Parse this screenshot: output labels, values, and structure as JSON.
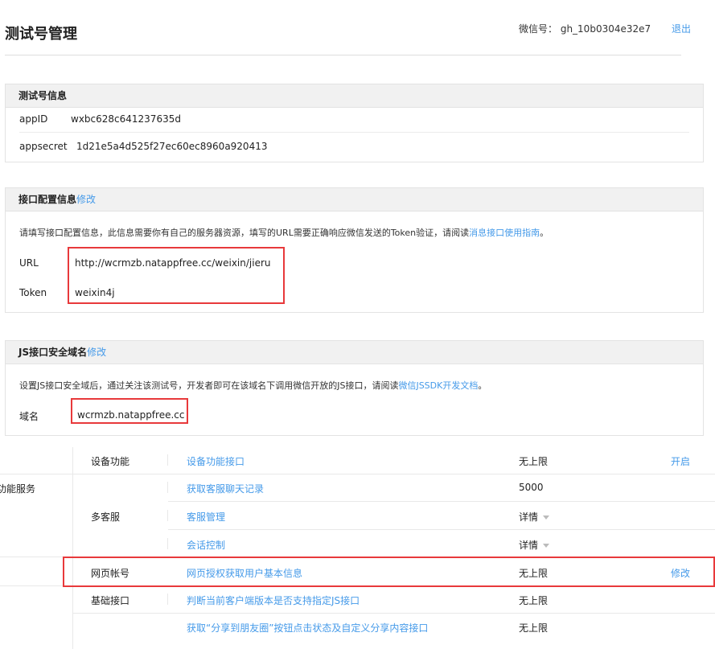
{
  "header": {
    "title": "测试号管理",
    "wechat_id_label": "微信号：",
    "wechat_id_value": "gh_10b0304e32e7",
    "logout": "退出"
  },
  "test_info": {
    "title": "测试号信息",
    "rows": [
      {
        "key": "appID",
        "value": "wxbc628c641237635d"
      },
      {
        "key": "appsecret",
        "value": "1d21e5a4d525f27ec60ec8960a920413"
      }
    ]
  },
  "api_config": {
    "title": "接口配置信息",
    "edit": "修改",
    "desc_prefix": "请填写接口配置信息，此信息需要你有自己的服务器资源，填写的URL需要正确响应微信发送的Token验证，请阅读",
    "desc_link": "消息接口使用指南",
    "desc_suffix": "。",
    "url_label": "URL",
    "url_value": "http://wcrmzb.natappfree.cc/weixin/jieru",
    "token_label": "Token",
    "token_value": "weixin4j"
  },
  "js_domain": {
    "title": "JS接口安全域名",
    "edit": "修改",
    "desc_prefix": "设置JS接口安全域后，通过关注该测试号，开发者即可在该域名下调用微信开放的JS接口，请阅读",
    "desc_link": "微信JSSDK开发文档",
    "desc_suffix": "。",
    "domain_label": "域名",
    "domain_value": "wcrmzb.natappfree.cc"
  },
  "functions": {
    "section_label": "功能服务",
    "rows": [
      {
        "category": "设备功能",
        "api": "设备功能接口",
        "limit": "无上限",
        "action": "开启"
      },
      {
        "category": "多客服",
        "api": "获取客服聊天记录",
        "limit": "5000",
        "action": ""
      },
      {
        "category": "",
        "api": "客服管理",
        "limit": "详情",
        "action": ""
      },
      {
        "category": "",
        "api": "会话控制",
        "limit": "详情",
        "action": ""
      },
      {
        "category": "网页帐号",
        "api": "网页授权获取用户基本信息",
        "limit": "无上限",
        "action": "修改"
      },
      {
        "category": "基础接口",
        "api": "判断当前客户端版本是否支持指定JS接口",
        "limit": "无上限",
        "action": ""
      },
      {
        "category": "",
        "api": "获取“分享到朋友圈”按钮点击状态及自定义分享内容接口",
        "limit": "无上限",
        "action": ""
      }
    ]
  },
  "colors": {
    "link": "#459ae9",
    "highlight": "#e8393b",
    "panel_header": "#f1f1f1"
  }
}
